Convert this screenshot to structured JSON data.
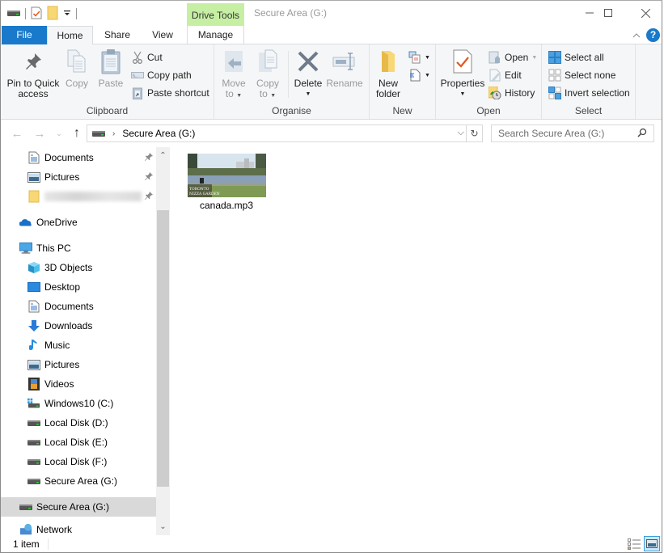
{
  "window": {
    "title": "Secure Area (G:)",
    "contextual_tab_group": "Drive Tools",
    "controls": {
      "minimize": "minimize",
      "maximize": "maximize",
      "close": "close"
    }
  },
  "quick_access_toolbar": {
    "icons": [
      "drive-icon",
      "properties-icon",
      "new-folder-icon",
      "customize-dropdown-icon"
    ]
  },
  "ribbon_tabs": [
    {
      "label": "File",
      "active": false
    },
    {
      "label": "Home",
      "active": true
    },
    {
      "label": "Share",
      "active": false
    },
    {
      "label": "View",
      "active": false
    },
    {
      "label": "Manage",
      "active": false
    }
  ],
  "ribbon": {
    "clipboard": {
      "label": "Clipboard",
      "pin_to_quick_access": "Pin to Quick access",
      "pin_line1": "Pin to Quick",
      "pin_line2": "access",
      "copy": "Copy",
      "paste": "Paste",
      "cut": "Cut",
      "copy_path": "Copy path",
      "paste_shortcut": "Paste shortcut"
    },
    "organise": {
      "label": "Organise",
      "move_to_line1": "Move",
      "move_to_line2": "to",
      "copy_to_line1": "Copy",
      "copy_to_line2": "to",
      "delete": "Delete",
      "rename": "Rename"
    },
    "new": {
      "label": "New",
      "new_folder_line1": "New",
      "new_folder_line2": "folder"
    },
    "open": {
      "label": "Open",
      "properties": "Properties",
      "open": "Open",
      "edit": "Edit",
      "history": "History"
    },
    "select": {
      "label": "Select",
      "select_all": "Select all",
      "select_none": "Select none",
      "invert_selection": "Invert selection"
    }
  },
  "navigation": {
    "address_path": "Secure Area (G:)",
    "search_placeholder": "Search Secure Area (G:)"
  },
  "nav_pane": {
    "items": [
      {
        "label": "Documents",
        "icon": "documents-icon",
        "pinned": true,
        "indent": 1
      },
      {
        "label": "Pictures",
        "icon": "pictures-icon",
        "pinned": true,
        "indent": 1
      },
      {
        "label": "",
        "icon": "folder-icon",
        "pinned": true,
        "indent": 1,
        "blurred": true
      },
      {
        "label": "OneDrive",
        "icon": "onedrive-icon",
        "indent": 0
      },
      {
        "label": "This PC",
        "icon": "this-pc-icon",
        "indent": 0
      },
      {
        "label": "3D Objects",
        "icon": "3d-objects-icon",
        "indent": 1
      },
      {
        "label": "Desktop",
        "icon": "desktop-icon",
        "indent": 1
      },
      {
        "label": "Documents",
        "icon": "documents-icon",
        "indent": 1
      },
      {
        "label": "Downloads",
        "icon": "downloads-icon",
        "indent": 1
      },
      {
        "label": "Music",
        "icon": "music-icon",
        "indent": 1
      },
      {
        "label": "Pictures",
        "icon": "pictures-icon",
        "indent": 1
      },
      {
        "label": "Videos",
        "icon": "videos-icon",
        "indent": 1
      },
      {
        "label": "Windows10 (C:)",
        "icon": "windows-drive-icon",
        "indent": 1
      },
      {
        "label": "Local Disk (D:)",
        "icon": "drive-icon",
        "indent": 1
      },
      {
        "label": "Local Disk (E:)",
        "icon": "drive-icon",
        "indent": 1
      },
      {
        "label": "Local Disk (F:)",
        "icon": "drive-icon",
        "indent": 1
      },
      {
        "label": "Secure Area (G:)",
        "icon": "drive-icon",
        "indent": 1
      },
      {
        "label": "Secure Area (G:)",
        "icon": "drive-icon",
        "indent": 0,
        "selected": true
      },
      {
        "label": "Network",
        "icon": "network-icon",
        "indent": 0
      }
    ]
  },
  "files": [
    {
      "name": "canada.mp3",
      "thumbnail_caption_line1": "TORONTO",
      "thumbnail_caption_line2": "NIZZA GARDEN"
    }
  ],
  "status": {
    "item_count": "1 item"
  },
  "colors": {
    "file_tab": "#1979ca",
    "drive_tools_tab": "#c6efa4",
    "selection": "#d9d9d9",
    "help": "#1979ca"
  }
}
